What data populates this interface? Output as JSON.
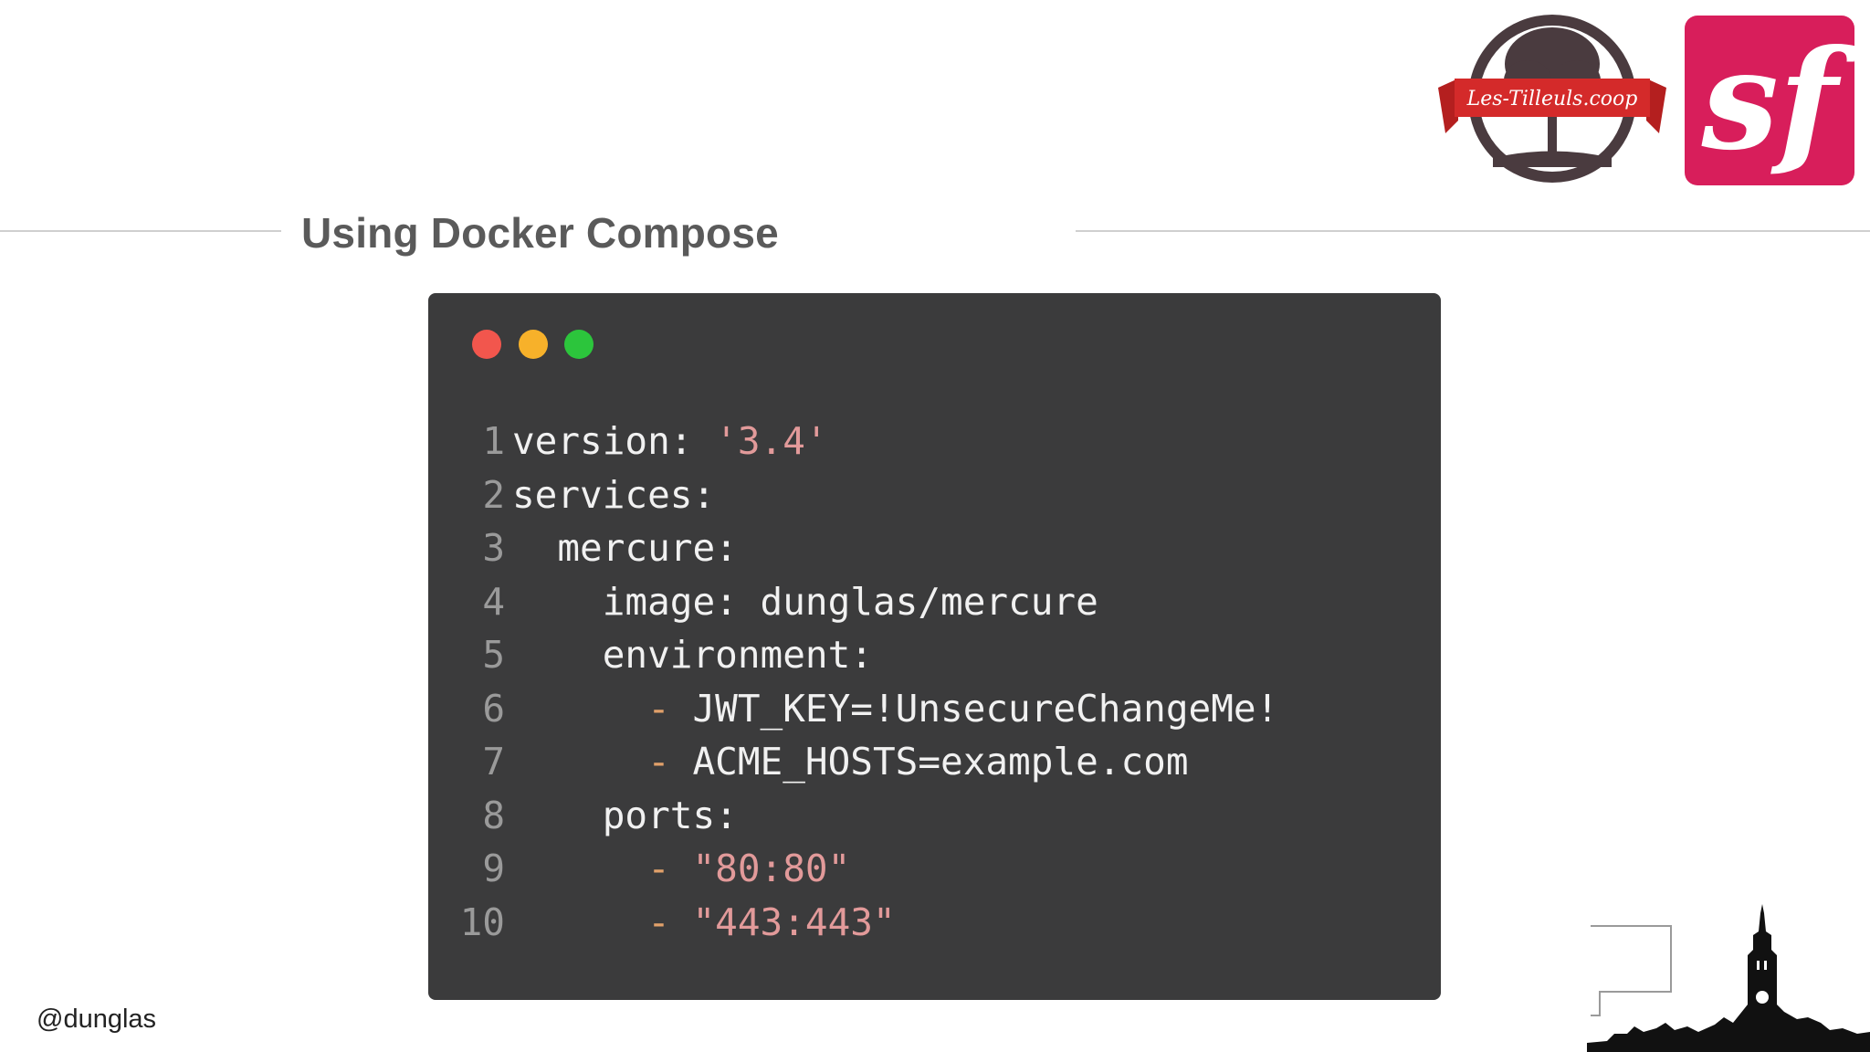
{
  "slide": {
    "title": "Using Docker Compose",
    "handle": "@dunglas"
  },
  "logos": {
    "tilleuls": "Les-Tilleuls.coop",
    "symfony": "sf"
  },
  "code": {
    "lines": [
      {
        "num": "1",
        "indent": "",
        "text": "version: ",
        "string": "'3.4'"
      },
      {
        "num": "2",
        "indent": "",
        "text": "services:"
      },
      {
        "num": "3",
        "indent": "  ",
        "text": "mercure:"
      },
      {
        "num": "4",
        "indent": "    ",
        "text": "image: dunglas/mercure"
      },
      {
        "num": "5",
        "indent": "    ",
        "text": "environment:"
      },
      {
        "num": "6",
        "indent": "      ",
        "dash": "- ",
        "text": "JWT_KEY=!UnsecureChangeMe!"
      },
      {
        "num": "7",
        "indent": "      ",
        "dash": "- ",
        "text": "ACME_HOSTS=example.com"
      },
      {
        "num": "8",
        "indent": "    ",
        "text": "ports:"
      },
      {
        "num": "9",
        "indent": "      ",
        "dash": "- ",
        "string": "\"80:80\""
      },
      {
        "num": "10",
        "indent": "      ",
        "dash": "- ",
        "string": "\"443:443\""
      }
    ]
  },
  "colors": {
    "code_background": "#3b3b3c",
    "symfony_brand": "#d81e5b",
    "tilleuls_ribbon": "#d42a2a",
    "string_color": "#e29a9a"
  }
}
